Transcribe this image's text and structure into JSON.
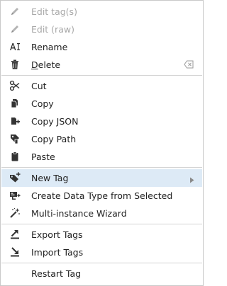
{
  "menu": {
    "edit_tags": "Edit tag(s)",
    "edit_raw": "Edit (raw)",
    "rename": "Rename",
    "delete_first": "D",
    "delete_rest": "elete",
    "cut": "Cut",
    "copy": "Copy",
    "copy_json": "Copy JSON",
    "copy_path": "Copy Path",
    "paste": "Paste",
    "new_tag": "New Tag",
    "create_data_type": "Create Data Type from Selected",
    "multi_instance_wizard": "Multi-instance Wizard",
    "export_tags": "Export Tags",
    "import_tags": "Import Tags",
    "restart_tag": "Restart Tag"
  },
  "icons": {
    "edit_tags": "pencil-icon",
    "edit_raw": "pencil-icon",
    "rename": "rename-icon",
    "delete": "trash-icon",
    "delete_shortcut": "delete-key-icon",
    "cut": "scissors-icon",
    "copy": "copy-icon",
    "copy_json": "copy-json-icon",
    "copy_path": "copy-path-icon",
    "paste": "clipboard-icon",
    "new_tag": "new-tag-icon",
    "submenu": "chevron-right-icon",
    "create_data_type": "create-data-type-icon",
    "multi_instance_wizard": "wand-icon",
    "export_tags": "export-icon",
    "import_tags": "import-icon"
  },
  "colors": {
    "highlight": "#ddeaf6",
    "text": "#222222",
    "disabled_text": "#a8a8a8",
    "separator": "#d4d4d4"
  }
}
